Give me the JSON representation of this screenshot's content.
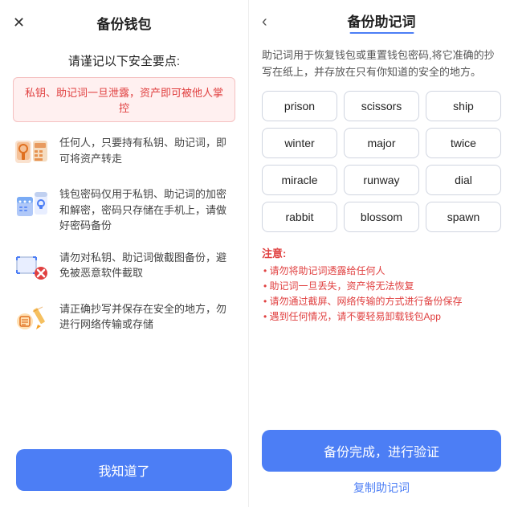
{
  "left": {
    "close_label": "✕",
    "title": "备份钱包",
    "subtitle": "请谨记以下安全要点:",
    "alert": "私钥、助记词一旦泄露，资产即可被他人掌控",
    "items": [
      {
        "text": "任何人，只要持有私钥、助记词，即可将资产转走",
        "icon": "key-icon"
      },
      {
        "text": "钱包密码仅用于私钥、助记词的加密和解密，密码只存储在手机上，请做好密码备份",
        "icon": "password-icon"
      },
      {
        "text": "请勿对私钥、助记词做截图备份，避免被恶意软件截取",
        "icon": "screenshot-icon"
      },
      {
        "text": "请正确抄写并保存在安全的地方，勿进行网络传输或存储",
        "icon": "note-icon"
      }
    ],
    "footer_button": "我知道了"
  },
  "right": {
    "back_label": "‹",
    "title": "备份助记词",
    "description": "助记词用于恢复钱包或重置钱包密码,将它准确的抄写在纸上，并存放在只有你知道的安全的地方。",
    "words": [
      "prison",
      "scissors",
      "ship",
      "winter",
      "major",
      "twice",
      "miracle",
      "runway",
      "dial",
      "rabbit",
      "blossom",
      "spawn"
    ],
    "notes_title": "注意:",
    "notes": [
      "• 请勿将助记词透露给任何人",
      "• 助记词一旦丢失，资产将无法恢复",
      "• 请勿通过截屏、网络传输的方式进行备份保存",
      "• 遇到任何情况，请不要轻易卸载钱包App"
    ],
    "primary_button": "备份完成，进行验证",
    "copy_link": "复制助记词"
  },
  "colors": {
    "accent": "#4c7ef5",
    "danger": "#e04040",
    "border": "#d0d5e0"
  }
}
